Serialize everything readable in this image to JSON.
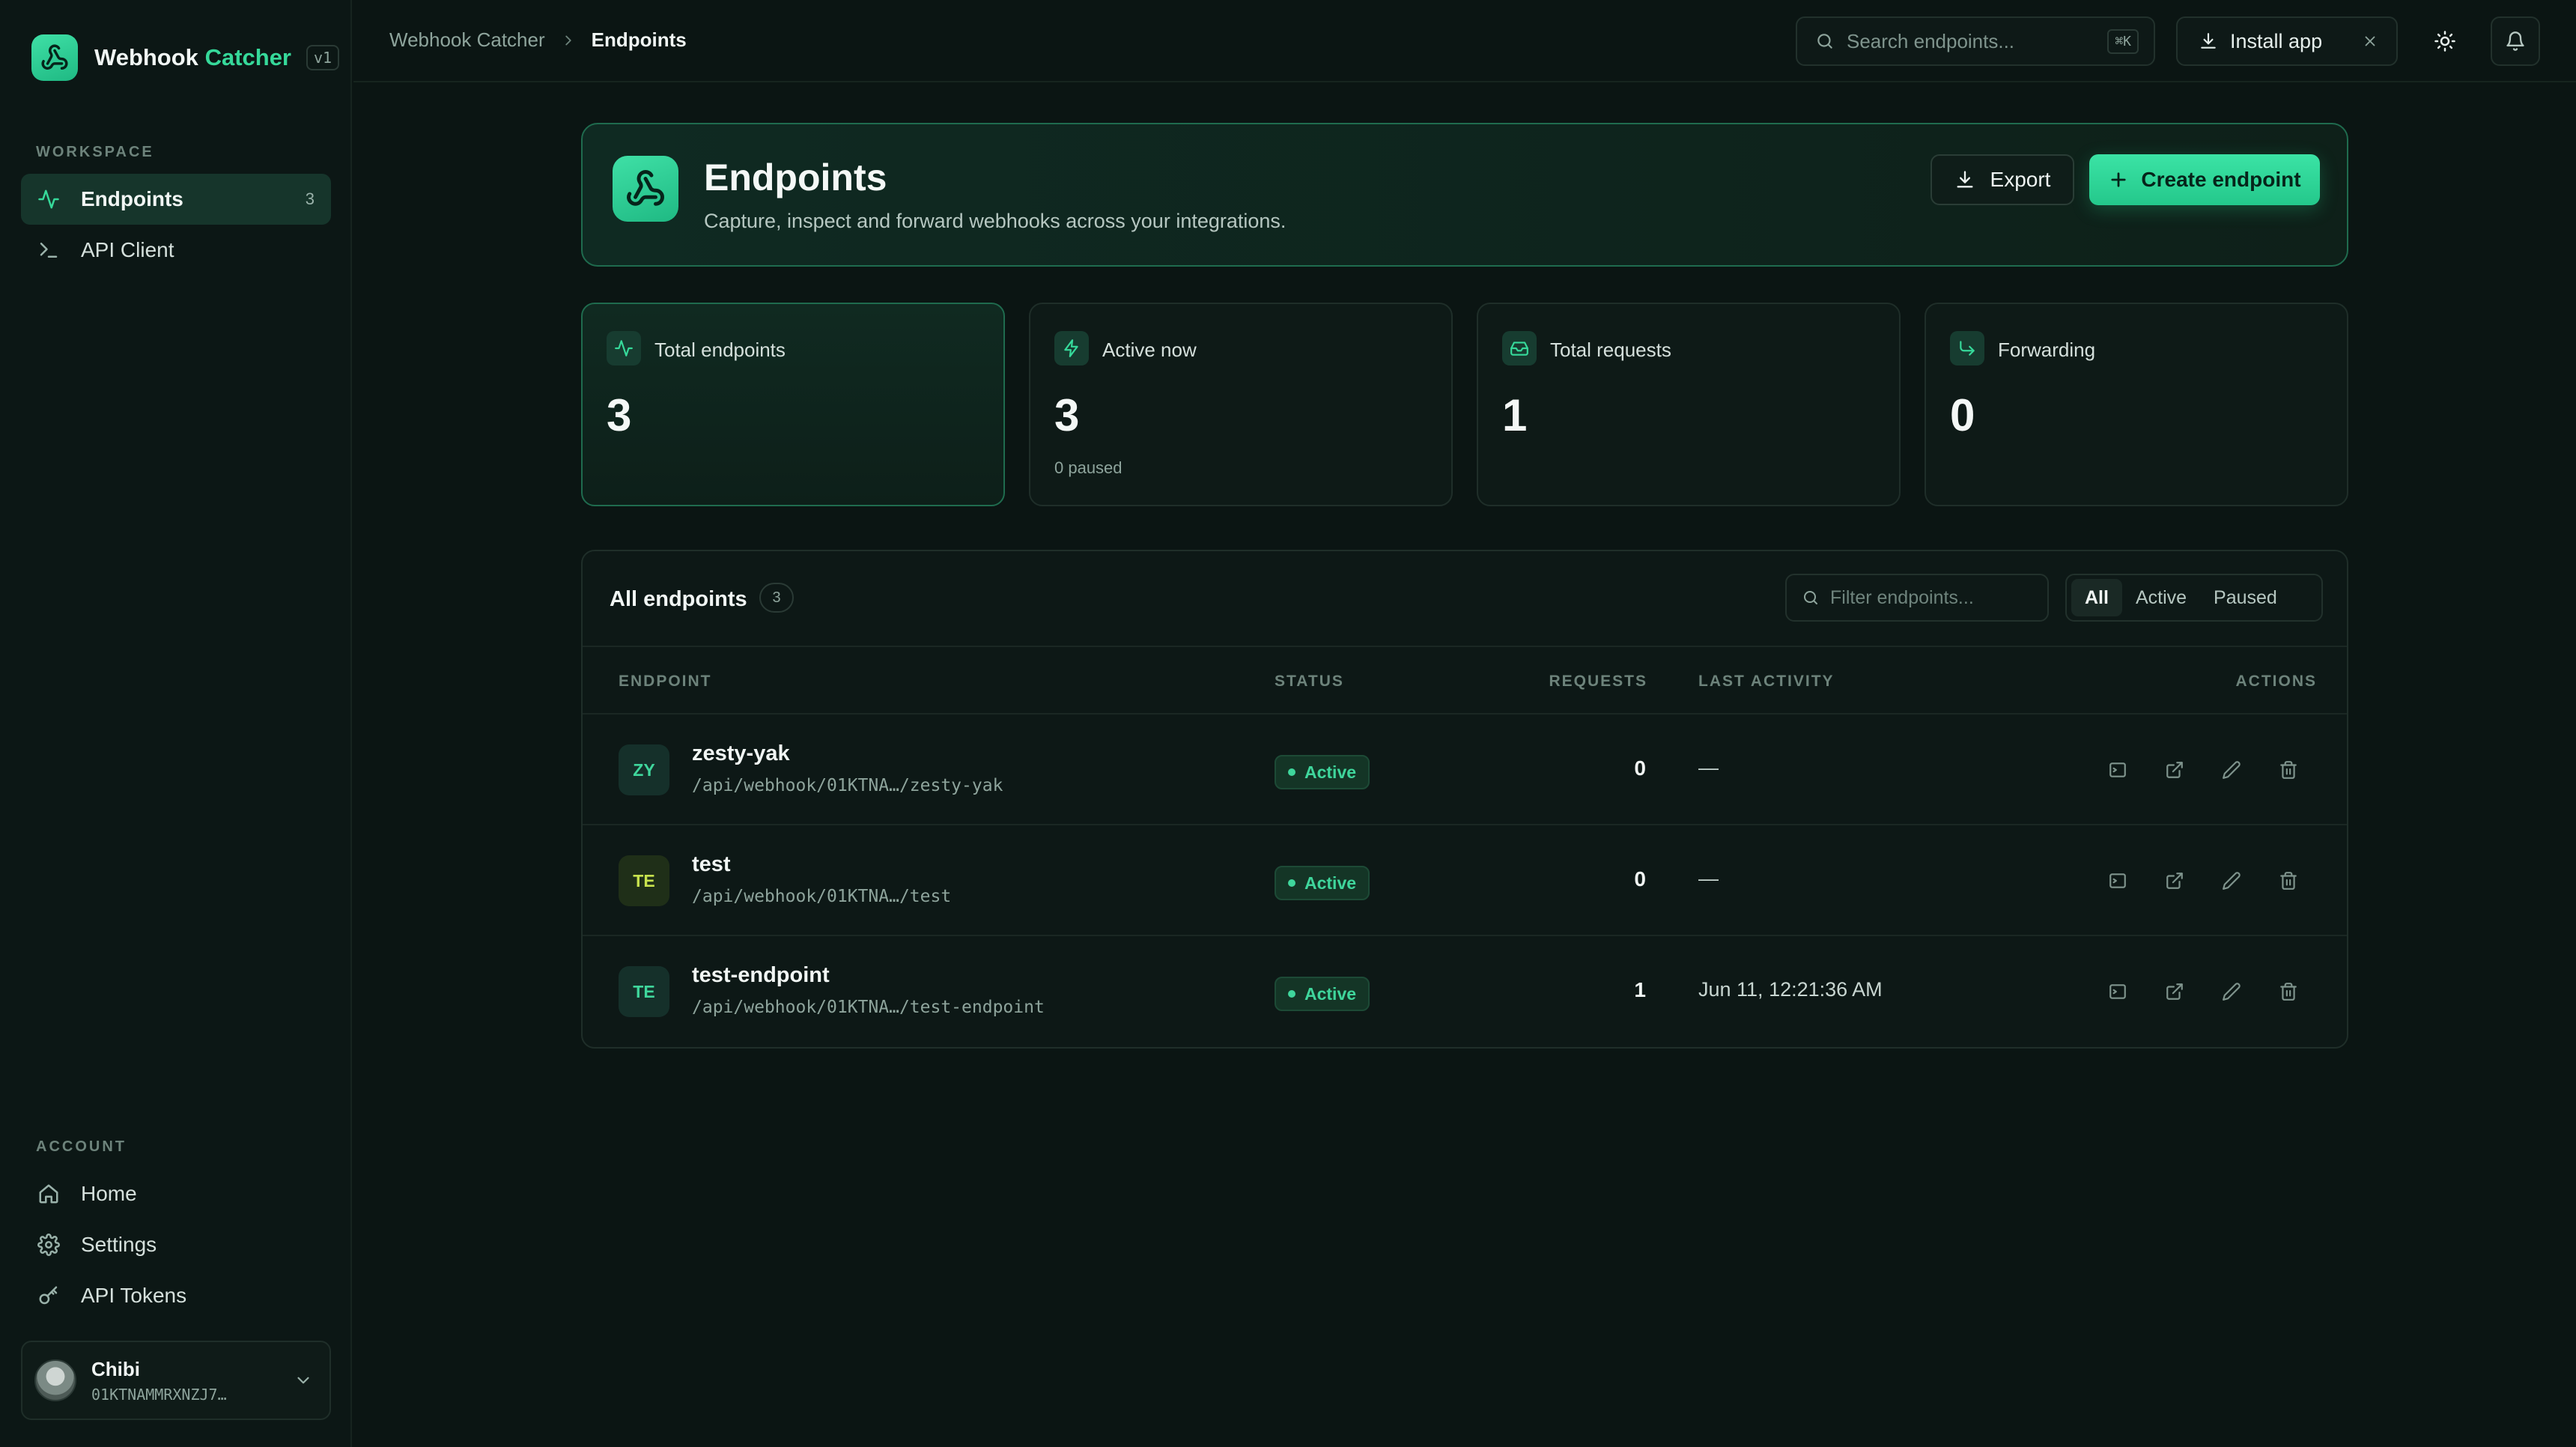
{
  "app": {
    "brand_primary": "Webhook",
    "brand_accent": "Catcher",
    "version": "v1",
    "accent_color": "#36d99a"
  },
  "sidebar": {
    "workspace_label": "WORKSPACE",
    "workspace_items": [
      {
        "label": "Endpoints",
        "icon": "activity-icon",
        "count": "3",
        "active": true
      },
      {
        "label": "API Client",
        "icon": "terminal-icon"
      }
    ],
    "account_label": "ACCOUNT",
    "account_items": [
      {
        "label": "Home",
        "icon": "home-icon"
      },
      {
        "label": "Settings",
        "icon": "gear-icon"
      },
      {
        "label": "API Tokens",
        "icon": "key-icon"
      }
    ],
    "user": {
      "name": "Chibi",
      "id": "01KTNAMMRXNZJ7…"
    }
  },
  "topbar": {
    "breadcrumb": [
      "Webhook Catcher",
      "Endpoints"
    ],
    "search_placeholder": "Search endpoints...",
    "search_shortcut": "⌘K",
    "install_label": "Install app"
  },
  "page": {
    "title": "Endpoints",
    "subtitle": "Capture, inspect and forward webhooks across your integrations.",
    "export_label": "Export",
    "create_label": "Create endpoint"
  },
  "stats": [
    {
      "label": "Total endpoints",
      "value": "3",
      "note": "",
      "icon": "activity-icon"
    },
    {
      "label": "Active now",
      "value": "3",
      "note": "0 paused",
      "icon": "bolt-icon"
    },
    {
      "label": "Total requests",
      "value": "1",
      "note": "",
      "icon": "inbox-icon"
    },
    {
      "label": "Forwarding",
      "value": "0",
      "note": "",
      "icon": "forward-arrow-icon"
    }
  ],
  "table": {
    "title": "All endpoints",
    "count": "3",
    "filter_placeholder": "Filter endpoints...",
    "filters": [
      "All",
      "Active",
      "Paused"
    ],
    "active_filter": "All",
    "columns": [
      "ENDPOINT",
      "STATUS",
      "REQUESTS",
      "LAST ACTIVITY",
      "ACTIONS"
    ],
    "rows": [
      {
        "initials": "ZY",
        "name": "zesty-yak",
        "path": "/api/webhook/01KTNA…/zesty-yak",
        "status": "Active",
        "requests": "0",
        "last_activity": "—"
      },
      {
        "initials": "TE",
        "name": "test",
        "path": "/api/webhook/01KTNA…/test",
        "status": "Active",
        "requests": "0",
        "last_activity": "—"
      },
      {
        "initials": "TE",
        "name": "test-endpoint",
        "path": "/api/webhook/01KTNA…/test-endpoint",
        "status": "Active",
        "requests": "1",
        "last_activity": "Jun 11, 12:21:36 AM"
      }
    ]
  }
}
